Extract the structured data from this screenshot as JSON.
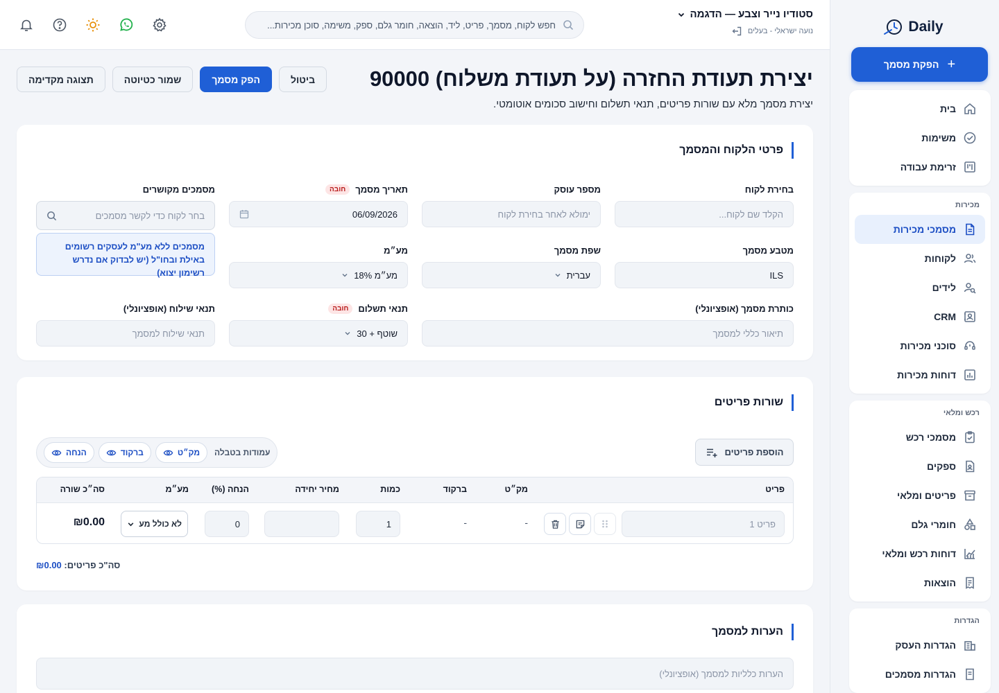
{
  "app": {
    "logo_text": "Daily"
  },
  "sidebar": {
    "issue_button": "הפקת מסמך",
    "groups": [
      {
        "title": "",
        "items": [
          {
            "label": "בית",
            "icon": "home-icon"
          },
          {
            "label": "משימות",
            "icon": "check-circle-icon"
          },
          {
            "label": "זרימת עבודה",
            "icon": "kanban-icon"
          }
        ]
      },
      {
        "title": "מכירות",
        "items": [
          {
            "label": "מסמכי מכירות",
            "icon": "document-icon",
            "active": true
          },
          {
            "label": "לקוחות",
            "icon": "users-icon"
          },
          {
            "label": "לידים",
            "icon": "user-search-icon"
          },
          {
            "label": "CRM",
            "icon": "contact-card-icon"
          },
          {
            "label": "סוכני מכירות",
            "icon": "headset-icon"
          },
          {
            "label": "דוחות מכירות",
            "icon": "bar-chart-icon"
          }
        ]
      },
      {
        "title": "רכש ומלאי",
        "items": [
          {
            "label": "מסמכי רכש",
            "icon": "clipboard-check-icon"
          },
          {
            "label": "ספקים",
            "icon": "file-user-icon"
          },
          {
            "label": "פריטים ומלאי",
            "icon": "archive-icon"
          },
          {
            "label": "חומרי גלם",
            "icon": "shapes-icon"
          },
          {
            "label": "דוחות רכש ומלאי",
            "icon": "line-chart-icon"
          },
          {
            "label": "הוצאות",
            "icon": "receipt-icon"
          }
        ]
      },
      {
        "title": "הגדרות",
        "items": [
          {
            "label": "הגדרות העסק",
            "icon": "building-icon"
          },
          {
            "label": "הגדרות מסמכים",
            "icon": "doc-settings-icon"
          }
        ]
      }
    ]
  },
  "topbar": {
    "business_name": "סטודיו נייר וצבע — הדגמה",
    "user_line": "נועה ישראלי - בעלים",
    "search_placeholder": "חפש לקוח, מסמך, פריט, ליד, הוצאה, חומר גלם, ספק, משימה, סוכן מכירות...",
    "icons": [
      "bell-icon",
      "help-icon",
      "sun-icon",
      "whatsapp-icon",
      "gear-icon"
    ],
    "colors": {
      "sun": "#e8910c",
      "whatsapp": "#22b14c"
    }
  },
  "page": {
    "title": "יצירת תעודת החזרה (על תעודת משלוח) 90000",
    "subtitle": "יצירת מסמך מלא עם שורות פריטים, תנאי תשלום וחישוב סכומים אוטומטי.",
    "buttons": {
      "cancel": "ביטול",
      "issue": "הפק מסמך",
      "draft": "שמור כטיוטה",
      "preview": "תצוגה מקדימה"
    }
  },
  "customer_section": {
    "title": "פרטי הלקוח והמסמך",
    "required_badge": "חובה",
    "customer_label": "בחירת לקוח",
    "customer_placeholder": "הקלד שם לקוח...",
    "dealer_label": "מספר עוסק",
    "dealer_placeholder": "ימולא לאחר בחירת לקוח",
    "date_label": "תאריך מסמך",
    "date_value": "06/09/2026",
    "related_label": "מסמכים מקושרים",
    "related_placeholder": "בחר לקוח כדי לקשר מסמכים",
    "currency_label": "מטבע מסמך",
    "currency_value": "ILS",
    "language_label": "שפת מסמך",
    "language_value": "עברית",
    "vat_label": "מע״מ",
    "vat_value": "מע״מ 18%",
    "vat_note": "מסמכים ללא מע\"מ לעסקים רשומים באילת ובחו\"ל (יש לבדוק אם נדרש רשימון יצוא)",
    "doc_title_label": "כותרת מסמך (אופציונלי)",
    "doc_title_placeholder": "תיאור כללי למסמך",
    "payment_label": "תנאי תשלום",
    "payment_value": "שוטף + 30",
    "shipping_label": "תנאי שילוח (אופציונלי)",
    "shipping_placeholder": "תנאי שילוח למסמך"
  },
  "items_section": {
    "title": "שורות פריטים",
    "add_button": "הוספת פריטים",
    "columns_label": "עמודות בטבלה",
    "column_chips": [
      "מק״ט",
      "ברקוד",
      "הנחה"
    ],
    "headers": {
      "item": "פריט",
      "sku": "מק״ט",
      "barcode": "ברקוד",
      "qty": "כמות",
      "unit_price": "מחיר יחידה",
      "discount": "הנחה (%)",
      "vat": "מע״מ",
      "line_total": "סה״כ שורה"
    },
    "rows": [
      {
        "item_placeholder": "פריט 1",
        "sku": "-",
        "barcode": "-",
        "qty": "1",
        "unit_price": "",
        "discount": "0",
        "vat": "לא כולל מע",
        "line_total": "₪0.00"
      }
    ],
    "total_label": "סה\"כ פריטים:",
    "total_value": "₪0.00"
  },
  "notes_section": {
    "title": "הערות למסמך",
    "placeholder": "הערות כלליות למסמך (אופציונלי)"
  }
}
